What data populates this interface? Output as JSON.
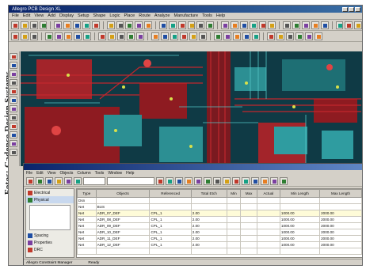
{
  "caption": "Fotos: Cadence Design Systems",
  "window": {
    "title": "Allegro PCB Design XL"
  },
  "menu": [
    "File",
    "Edit",
    "View",
    "Add",
    "Display",
    "Setup",
    "Shape",
    "Logic",
    "Place",
    "Route",
    "Analyze",
    "Manufacture",
    "Tools",
    "Help"
  ],
  "sub_window": {
    "menu": [
      "File",
      "Edit",
      "View",
      "Objects",
      "Column",
      "Tools",
      "Window",
      "Help"
    ],
    "nav": [
      {
        "label": "Electrical",
        "icon_color": "#c0392b"
      },
      {
        "label": "Physical",
        "icon_color": "#2e7d32"
      },
      {
        "label": "Spacing",
        "icon_color": "#1f4ea3"
      },
      {
        "label": "Properties",
        "icon_color": "#7b3fa0"
      },
      {
        "label": "DRC",
        "icon_color": "#c0392b"
      }
    ],
    "columns": [
      "Type",
      "Objects",
      "Referenced",
      "Total Etch",
      "Min",
      "Max",
      "Actual",
      "Min Length",
      "Max Length"
    ],
    "rows": [
      [
        "Dsn",
        "",
        "",
        "",
        "",
        "",
        "",
        "",
        ""
      ],
      [
        "Net",
        "BUS",
        "",
        "",
        "",
        "",
        "",
        "",
        ""
      ],
      [
        "Net",
        "ADR_07_DEF",
        "CPL_1",
        "2.00",
        "",
        "",
        "",
        "1000.00",
        "2000.00"
      ],
      [
        "Net",
        "ADR_08_DEF",
        "CPL_1",
        "2.00",
        "",
        "",
        "",
        "1000.00",
        "2000.00"
      ],
      [
        "Net",
        "ADR_09_DEF",
        "CPL_1",
        "2.00",
        "",
        "",
        "",
        "1000.00",
        "2000.00"
      ],
      [
        "Net",
        "ADR_10_DEF",
        "CPL_1",
        "2.00",
        "",
        "",
        "",
        "1000.00",
        "2000.00"
      ],
      [
        "Net",
        "ADR_11_DEF",
        "CPL_1",
        "2.00",
        "",
        "",
        "",
        "1000.00",
        "2000.00"
      ],
      [
        "Net",
        "ADR_12_DEF",
        "CPL_1",
        "2.00",
        "",
        "",
        "",
        "1000.00",
        "2000.00"
      ]
    ],
    "status": "Allegro Constraint Manager",
    "status_right": "Ready"
  },
  "colors": {
    "canvas": "#0f3a45",
    "trace_red": "#c1272d",
    "trace_teal": "#34a9a9",
    "title_blue": "#0a246a"
  }
}
